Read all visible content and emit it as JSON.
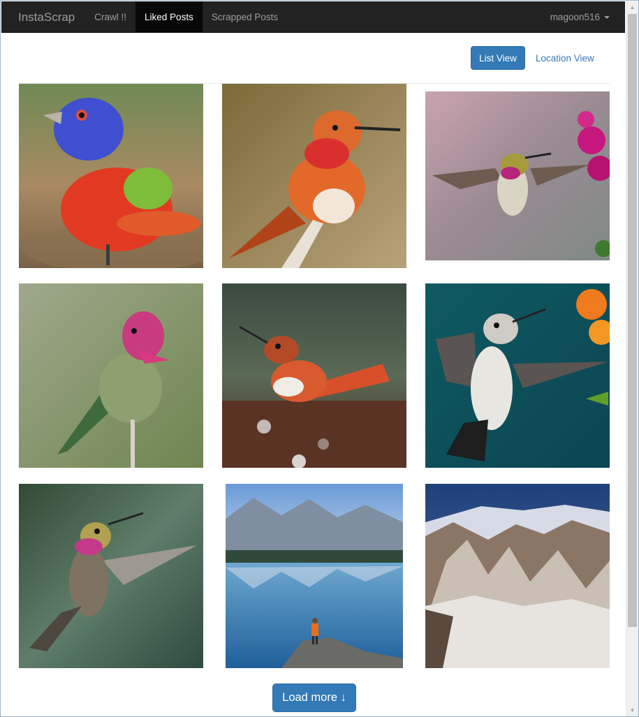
{
  "navbar": {
    "brand": "InstaScrap",
    "links": [
      "Crawl !!",
      "Liked Posts",
      "Scrapped Posts"
    ],
    "active_link": "Liked Posts",
    "user": "magoon516"
  },
  "view_toggle": {
    "list_view": "List View",
    "location_view": "Location View",
    "active": "List View"
  },
  "posts": [
    {
      "subject": "painted bunting"
    },
    {
      "subject": "rufous hummingbird on branch"
    },
    {
      "subject": "hummingbird hovering near pink flower"
    },
    {
      "subject": "anna's hummingbird perched"
    },
    {
      "subject": "hummingbird bathing"
    },
    {
      "subject": "hummingbird near orange flowers"
    },
    {
      "subject": "hummingbird in flight"
    },
    {
      "subject": "mountain lake with person"
    },
    {
      "subject": "snowy mountain range"
    }
  ],
  "load_more": "Load more ↓",
  "colors": {
    "navbar_bg": "#222222",
    "navbar_active_bg": "#080808",
    "primary": "#337ab7",
    "link": "#337ab7"
  }
}
